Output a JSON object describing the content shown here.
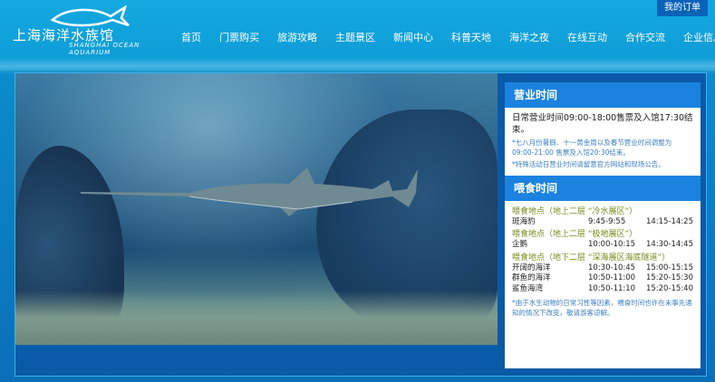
{
  "header": {
    "logo_cn": "上海海洋水族馆",
    "logo_en": "SHANGHAI OCEAN AQUARIUM",
    "my_order": "我的订单",
    "nav": [
      "首页",
      "门票购买",
      "旅游攻略",
      "主题景区",
      "新闻中心",
      "科普天地",
      "海洋之夜",
      "在线互动",
      "合作交流",
      "企业信息"
    ]
  },
  "hours": {
    "title": "营业时间",
    "main": "日常营业时间09:00-18:00售票及入馆17:30结束。",
    "note1": "*七八月份暑假、十一黄金周以及春节营业时间调整为09:00-21:00 售票及入馆20:30结束。",
    "note2": "*特殊活动日营业时间请留意官方网站和现场公告。"
  },
  "feeding": {
    "title": "喂食时间",
    "groups": [
      {
        "location": "喂食地点（地上二层 “冷水展区”）",
        "rows": [
          {
            "name": "斑海豹",
            "t1": "9:45-9:55",
            "t2": "14:15-14:25"
          }
        ]
      },
      {
        "location": "喂食地点（地上二层 “极地展区”）",
        "rows": [
          {
            "name": "企鹅",
            "t1": "10:00-10:15",
            "t2": "14:30-14:45"
          }
        ]
      },
      {
        "location": "喂食地点（地下二层 “深海展区海底隧道”）",
        "rows": [
          {
            "name": "开阔的海洋",
            "t1": "10:30-10:45",
            "t2": "15:00-15:15"
          },
          {
            "name": "群鱼的海洋",
            "t1": "10:50-11:00",
            "t2": "15:20-15:30"
          },
          {
            "name": "鲨鱼海湾",
            "t1": "10:50-11:10",
            "t2": "15:20-15:40"
          }
        ]
      }
    ],
    "note": "*由于水生动物的日常习性等因素，喂食时间也许在未事先通知的情况下改变，敬请游客谅解。"
  }
}
